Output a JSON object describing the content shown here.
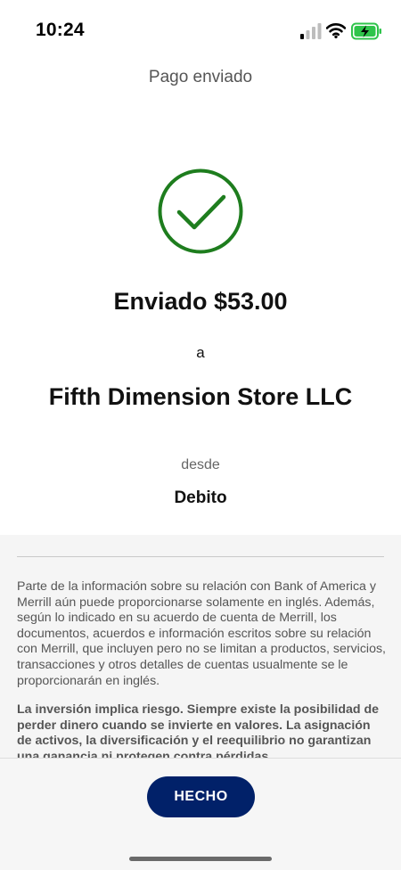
{
  "status_bar": {
    "time": "10:24",
    "icons": [
      "signal-icon",
      "wifi-icon",
      "battery-charging-icon"
    ],
    "battery_color": "#2fc44b"
  },
  "header": {
    "title": "Pago enviado"
  },
  "confirmation": {
    "icon": "check-circle-icon",
    "icon_color": "#1e7d1e",
    "amount_text": "Enviado $53.00",
    "to_label": "a",
    "recipient": "Fifth Dimension Store LLC",
    "from_label": "desde",
    "from_account": "Debito"
  },
  "disclosure": {
    "language_notice": "Parte de la información sobre su relación con Bank of America y Merrill aún puede proporcionarse solamente en inglés. Además, según lo indicado en su acuerdo de cuenta de Merrill, los documentos, acuerdos e información escritos sobre su relación con Merrill, que incluyen pero no se limitan a productos, servicios, transacciones y otros detalles de cuentas usualmente se le proporcionarán en inglés.",
    "risk_notice": "La inversión implica riesgo. Siempre existe la posibilidad de perder dinero cuando se invierte en valores. La asignación de activos, la diversificación y el reequilibrio no garantizan una ganancia ni protegen contra pérdidas"
  },
  "footer": {
    "done_label": "HECHO",
    "button_color": "#012169"
  }
}
